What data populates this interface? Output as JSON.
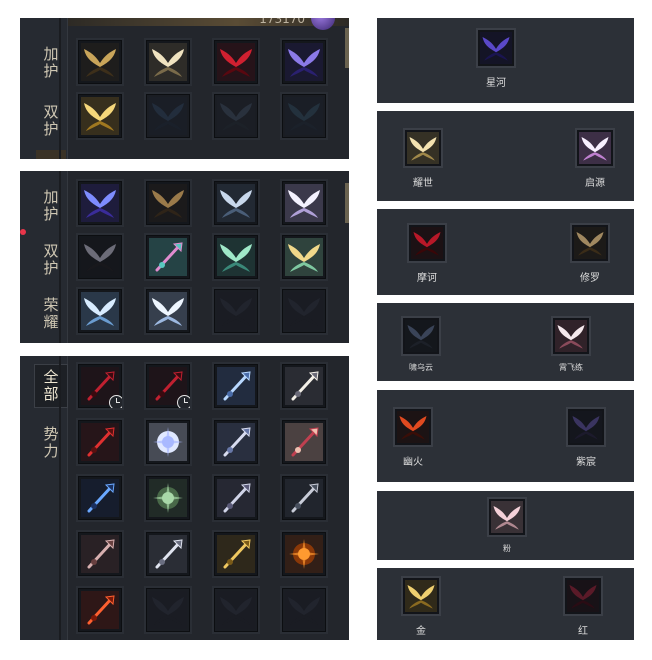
{
  "panel_top": {
    "counter": "173170",
    "tabs": [
      {
        "label": [
          "加",
          "护"
        ]
      },
      {
        "label": [
          "双",
          "护"
        ]
      }
    ],
    "rows": [
      [
        "golden-dark-wings-icon",
        "cream-feather-wings-icon",
        "crimson-wings-icon",
        "violet-wings-icon"
      ],
      [
        "golden-glow-wings-icon",
        "locked-blue-wings-icon",
        "locked-slate-wings-icon",
        "locked-teal-wings-icon"
      ]
    ]
  },
  "panel_middle": {
    "tabs": [
      {
        "label": [
          "加",
          "护"
        ]
      },
      {
        "label": [
          "双",
          "护"
        ]
      },
      {
        "label": [
          "荣",
          "耀"
        ]
      }
    ],
    "rows": [
      [
        "blue-violet-wings-icon",
        "bronze-wings-icon",
        "silver-wings-icon",
        "white-angel-wings-icon"
      ],
      [
        "dark-butterfly-wings-icon",
        "rainbow-wings-icon",
        "jade-wings-icon",
        "golden-green-wings-icon"
      ],
      [
        "ice-wings-icon",
        "frost-wings-icon",
        "locked-dark-icon",
        "locked-dark-icon"
      ]
    ]
  },
  "panel_weapons": {
    "tabs": [
      {
        "label": [
          "全",
          "部"
        ]
      },
      {
        "label": [
          "势",
          "力"
        ]
      }
    ],
    "rows": [
      [
        "red-spear-icon",
        "red-spear-icon",
        "ice-blade-icon",
        "pearl-staff-icon"
      ],
      [
        "flame-trident-icon",
        "star-orb-icon",
        "moon-staff-icon",
        "crimson-lance-icon"
      ],
      [
        "azure-halberd-icon",
        "jade-fan-icon",
        "silver-scepter-icon",
        "steel-spear-icon"
      ],
      [
        "crescent-bow-icon",
        "curved-saber-icon",
        "gold-sword-icon",
        "fire-orb-icon"
      ],
      [
        "ember-whip-icon",
        "locked-dark-icon",
        "locked-dark-icon",
        "locked-dark-icon"
      ]
    ],
    "timed_slots": [
      "0",
      "1"
    ]
  },
  "items": [
    {
      "name": "星河",
      "icon": "star-river-wings-icon"
    },
    {
      "name": "耀世",
      "icon": "radiant-wings-icon"
    },
    {
      "name": "启源",
      "icon": "origin-wings-icon"
    },
    {
      "name": "摩诃",
      "icon": "maha-wings-icon"
    },
    {
      "name": "修罗",
      "icon": "asura-wings-icon"
    },
    {
      "name": "啸乌云",
      "icon": "dark-cloud-wings-icon"
    },
    {
      "name": "霄飞练",
      "icon": "sky-silk-wings-icon"
    },
    {
      "name": "幽火",
      "icon": "ghost-fire-wings-icon"
    },
    {
      "name": "紫宸",
      "icon": "purple-star-wings-icon"
    },
    {
      "name": "粉",
      "icon": "pink-feather-icon"
    },
    {
      "name": "金",
      "icon": "gold-feather-icon"
    },
    {
      "name": "红",
      "icon": "red-feather-icon"
    }
  ]
}
